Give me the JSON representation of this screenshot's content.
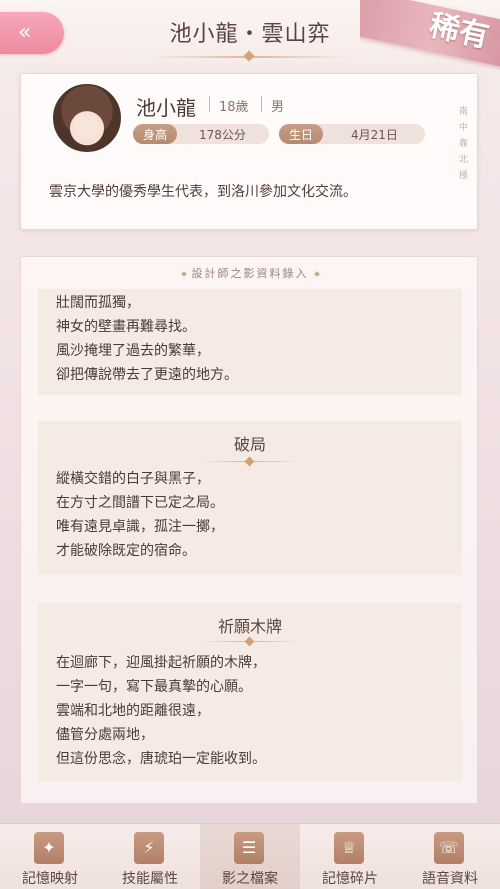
{
  "header": {
    "title": "池小龍・雲山弈",
    "back_icon": "double-chevron-left-icon",
    "rarity": "稀有"
  },
  "profile": {
    "name": "池小龍",
    "age": "18歲",
    "gender": "男",
    "height_label": "身高",
    "height_value": "178公分",
    "birthday_label": "生日",
    "birthday_value": "4月21日",
    "description": "雲京大學的優秀學生代表，到洛川參加文化交流。",
    "side_text": [
      "南",
      "中",
      "靠",
      "北",
      "極"
    ]
  },
  "archive": {
    "heading": "設計師之影資料錄入",
    "entries": [
      {
        "title": "",
        "lines": [
          "壯闊而孤獨，",
          "神女的壁畫再難尋找。",
          "風沙掩埋了過去的繁華，",
          "卻把傳說帶去了更遠的地方。"
        ]
      },
      {
        "title": "破局",
        "lines": [
          "縱橫交錯的白子與黑子，",
          "在方寸之間譜下已定之局。",
          "唯有遠見卓識，孤注一擲，",
          "才能破除既定的宿命。"
        ]
      },
      {
        "title": "祈願木牌",
        "lines": [
          "在迴廊下，迎風掛起祈願的木牌，",
          "一字一句，寫下最真摯的心願。",
          "雲端和北地的距離很遠，",
          "儘管分處兩地，",
          "但這份思念，唐琥珀一定能收到。"
        ]
      }
    ]
  },
  "nav": {
    "active_index": 2,
    "items": [
      {
        "label": "記憶映射",
        "icon": "sparkle-card-icon"
      },
      {
        "label": "技能屬性",
        "icon": "lightning-hexagon-icon"
      },
      {
        "label": "影之檔案",
        "icon": "document-icon"
      },
      {
        "label": "記憶碎片",
        "icon": "dress-icon"
      },
      {
        "label": "語音資料",
        "icon": "phone-voice-icon"
      }
    ]
  }
}
